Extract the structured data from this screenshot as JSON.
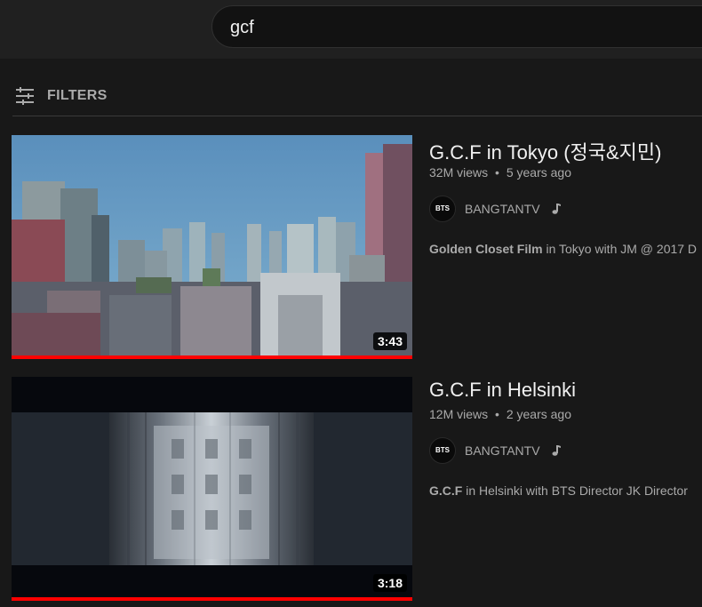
{
  "search": {
    "query": "gcf"
  },
  "filters": {
    "label": "FILTERS",
    "icon": "filters-icon"
  },
  "results": [
    {
      "title": "G.C.F in Tokyo (정국&지민)",
      "views": "32M views",
      "age": "5 years ago",
      "channel": "BANGTANTV",
      "avatar_text": "BTS",
      "duration": "3:43",
      "desc_bold": "Golden Closet Film",
      "desc_rest": " in Tokyo with JM @ 2017 D",
      "progress_fraction": 1.0
    },
    {
      "title": "G.C.F in Helsinki",
      "views": "12M views",
      "age": "2 years ago",
      "channel": "BANGTANTV",
      "avatar_text": "BTS",
      "duration": "3:18",
      "desc_bold": "G.C.F",
      "desc_rest": " in Helsinki with BTS Director JK Director",
      "progress_fraction": 1.0
    }
  ],
  "meta_separator": "•",
  "colors": {
    "progress": "#ff0000",
    "background": "#181818"
  }
}
